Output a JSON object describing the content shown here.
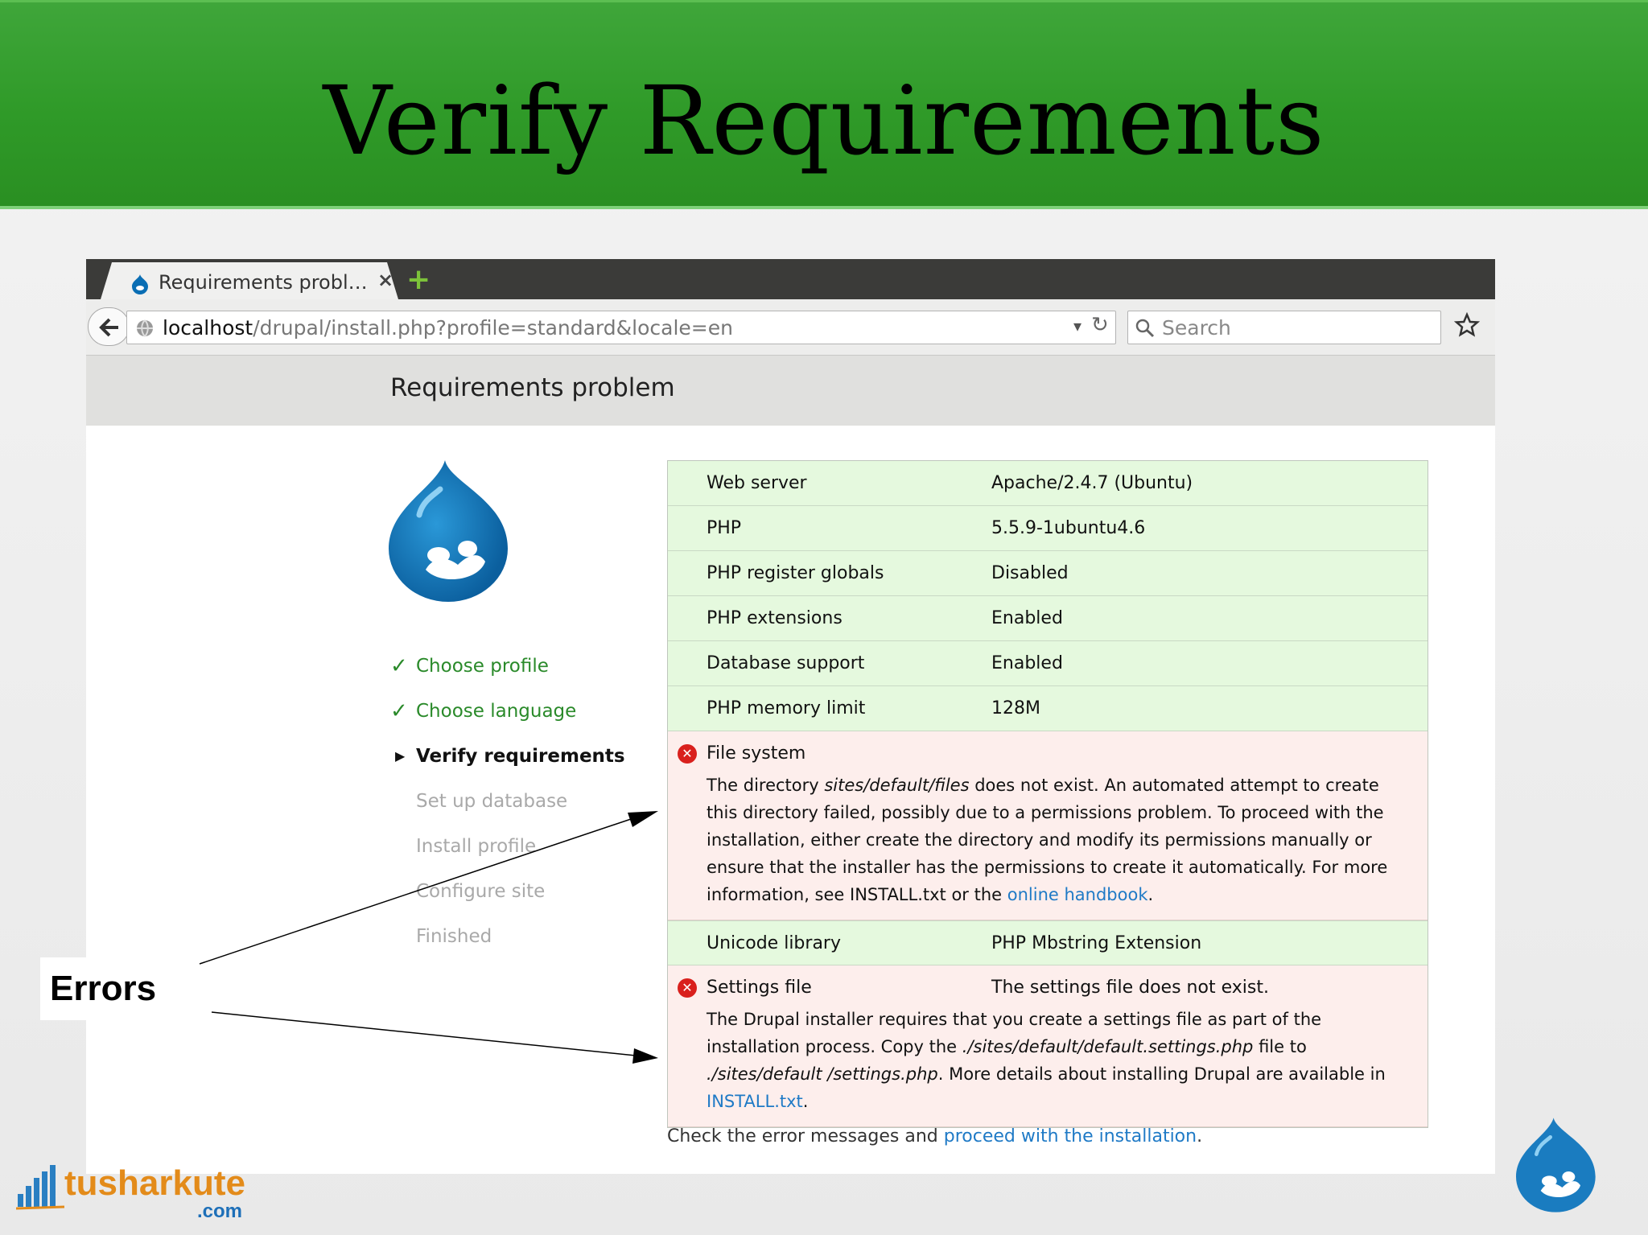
{
  "slide": {
    "title": "Verify Requirements",
    "annotation": "Errors"
  },
  "browser": {
    "tab_title": "Requirements probl…",
    "tab_close": "×",
    "new_tab": "+",
    "url_host": "localhost",
    "url_path": "/drupal/install.php?profile=standard&locale=en",
    "search_placeholder": "Search"
  },
  "page": {
    "title": "Requirements problem",
    "steps": [
      {
        "label": "Choose profile",
        "state": "done"
      },
      {
        "label": "Choose language",
        "state": "done"
      },
      {
        "label": "Verify requirements",
        "state": "active"
      },
      {
        "label": "Set up database",
        "state": "todo"
      },
      {
        "label": "Install profile",
        "state": "todo"
      },
      {
        "label": "Configure site",
        "state": "todo"
      },
      {
        "label": "Finished",
        "state": "todo"
      }
    ],
    "requirements": [
      {
        "label": "Web server",
        "value": "Apache/2.4.7 (Ubuntu)",
        "status": "ok"
      },
      {
        "label": "PHP",
        "value": "5.5.9-1ubuntu4.6",
        "status": "ok"
      },
      {
        "label": "PHP register globals",
        "value": "Disabled",
        "status": "ok"
      },
      {
        "label": "PHP extensions",
        "value": "Enabled",
        "status": "ok"
      },
      {
        "label": "Database support",
        "value": "Enabled",
        "status": "ok"
      },
      {
        "label": "PHP memory limit",
        "value": "128M",
        "status": "ok"
      },
      {
        "label": "File system",
        "value": "",
        "status": "error",
        "desc": {
          "t1": "The directory ",
          "em1": "sites/default/files",
          "t2": " does not exist. An automated attempt to create this directory failed, possibly due to a permissions problem. To proceed with the installation, either create the directory and modify its permissions manually or ensure that the installer has the permissions to create it automatically. For more information, see INSTALL.txt or the ",
          "link": "online handbook",
          "t3": "."
        }
      },
      {
        "label": "Unicode library",
        "value": "PHP Mbstring Extension",
        "status": "ok"
      },
      {
        "label": "Settings file",
        "value": "The settings file does not exist.",
        "status": "error",
        "desc": {
          "t1": "The Drupal installer requires that you create a settings file as part of the installation process. Copy the ",
          "em1": "./sites/default/default.settings.php",
          "t2": " file to ",
          "em2": "./sites/default /settings.php",
          "t3": ". More details about installing Drupal are available in ",
          "link": "INSTALL.txt",
          "t4": "."
        }
      }
    ],
    "footer": {
      "text": "Check the error messages and ",
      "link": "proceed with the installation",
      "end": "."
    }
  },
  "branding": {
    "name": "tusharkute",
    "domain": ".com"
  },
  "colors": {
    "header_green": "#2f9a28",
    "ok_row": "#e5f9de",
    "error_row": "#fdeeec",
    "link": "#1f7ac6",
    "done_step": "#2a8a2a",
    "error_icon": "#d9201d"
  },
  "icons": [
    "drupal-favicon-icon",
    "back-arrow-icon",
    "globe-icon",
    "dropdown-icon",
    "reload-icon",
    "search-icon",
    "bookmark-star-icon",
    "drupal-logo-icon",
    "checkmark-icon",
    "triangle-right-icon",
    "error-x-icon",
    "arrow-icon"
  ]
}
